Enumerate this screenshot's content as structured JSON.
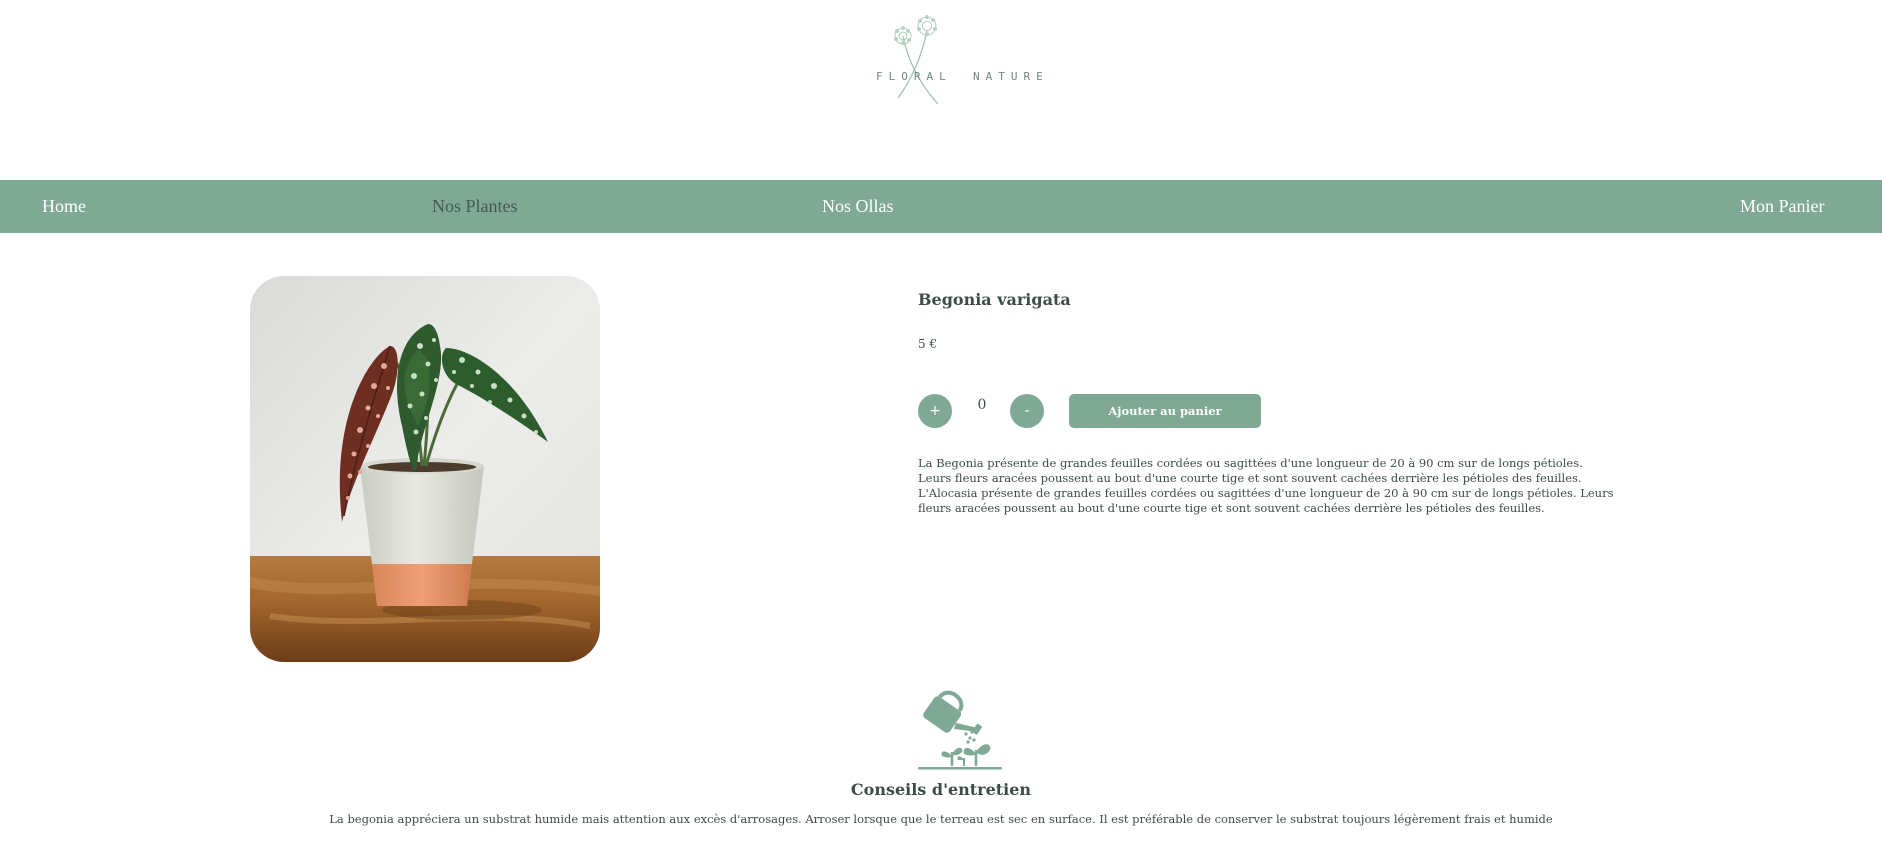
{
  "brand": {
    "logo_word_left": "FLORAL",
    "logo_word_right": "NATURE",
    "logo_icon": "dandelion-logo-icon",
    "color_logo": "#8fb59f"
  },
  "nav": {
    "items": [
      {
        "label": "Home"
      },
      {
        "label": "Nos Plantes"
      },
      {
        "label": "Nos Ollas"
      },
      {
        "label": "Mon Panier"
      }
    ],
    "background": "#7fa994",
    "active_item_color": "#445a50"
  },
  "product": {
    "image_alt": "Begonia varigata in a white and terracotta pot",
    "name": "Begonia varigata",
    "price": "5 €",
    "quantity": "0",
    "plus_label": "+",
    "minus_label": "-",
    "add_to_cart_label": "Ajouter au panier",
    "description": "La Begonia présente de grandes feuilles cordées ou sagittées d'une longueur de 20 à 90 cm sur de longs pétioles. Leurs fleurs aracées poussent au bout d'une courte tige et sont souvent cachées derrière les pétioles des feuilles. L'Alocasia présente de grandes feuilles cordées ou sagittées d'une longueur de 20 à 90 cm sur de longs pétioles. Leurs fleurs aracées poussent au bout d'une courte tige et sont souvent cachées derrière les pétioles des feuilles."
  },
  "care": {
    "icon": "watering-can-icon",
    "title": "Conseils d'entretien",
    "text": "La begonia appréciera un substrat humide mais attention aux excès d'arrosages. Arroser lorsque que le terreau est sec en surface. Il est préférable de conserver le substrat toujours légèrement frais et humide"
  },
  "colors": {
    "accent": "#7fa994",
    "text": "#3c4d45"
  }
}
